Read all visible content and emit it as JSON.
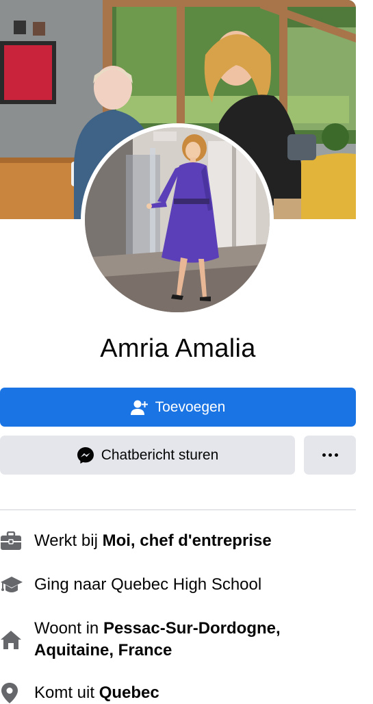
{
  "profile": {
    "name": "Amria Amalia"
  },
  "actions": {
    "add_label": "Toevoegen",
    "add_icon": "add-friend-icon",
    "chat_label": "Chatbericht sturen",
    "chat_icon": "messenger-icon",
    "more_icon": "more-icon"
  },
  "details": [
    {
      "icon": "briefcase-icon",
      "prefix": "Werkt bij ",
      "bold": "Moi, chef d'entreprise",
      "suffix": ""
    },
    {
      "icon": "graduation-cap-icon",
      "prefix": "Ging naar Quebec High School",
      "bold": "",
      "suffix": ""
    },
    {
      "icon": "home-icon",
      "prefix": "Woont in ",
      "bold": "Pessac-Sur-Dordogne, Aquitaine, France",
      "suffix": ""
    },
    {
      "icon": "location-pin-icon",
      "prefix": "Komt uit ",
      "bold": "Quebec",
      "suffix": ""
    }
  ],
  "colors": {
    "primary": "#1b74e4",
    "secondary_button": "#e4e6eb",
    "icon_gray": "#65676b",
    "divider": "#ced0d4",
    "text": "#050505"
  }
}
